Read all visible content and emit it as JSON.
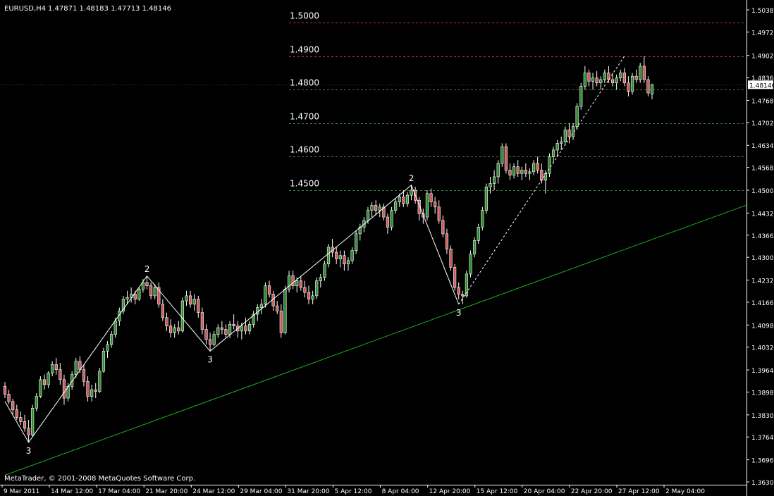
{
  "header": {
    "symbol": "EURUSD,H4",
    "ohlc": "1.47871 1.48183 1.47713 1.48146"
  },
  "footer": {
    "copyright": "MetaTrader, © 2001-2008 MetaQuotes Software Corp."
  },
  "colors": {
    "background": "#000000",
    "axis": "#ffffff",
    "candle_up": "#2e8b2e",
    "candle_down": "#cc5a5a",
    "fib_red": "#a84040",
    "fib_green": "#3a8a3a",
    "trendline": "#1fae1f",
    "wave": "#ffffff",
    "price_box": "#ffffff"
  },
  "chart_data": {
    "type": "candlestick",
    "title": "EURUSD,H4",
    "price_axis_ticks": [
      "1.50380",
      "1.49720",
      "1.49020",
      "1.48360",
      "1.48146",
      "1.47680",
      "1.47020",
      "1.46340",
      "1.45680",
      "1.45000",
      "1.44320",
      "1.43660",
      "1.43000",
      "1.42320",
      "1.41660",
      "1.40980",
      "1.40320",
      "1.39640",
      "1.38980",
      "1.38300",
      "1.37640",
      "1.36960",
      "1.36300"
    ],
    "time_axis_ticks": [
      "9 Mar 2011",
      "14 Mar 12:00",
      "17 Mar 04:00",
      "21 Mar 20:00",
      "24 Mar 12:00",
      "29 Mar 04:00",
      "31 Mar 20:00",
      "5 Apr 12:00",
      "8 Apr 04:00",
      "12 Apr 20:00",
      "15 Apr 12:00",
      "20 Apr 04:00",
      "22 Apr 20:00",
      "27 Apr 12:00",
      "2 May 04:00"
    ],
    "ylim": [
      1.363,
      1.5038
    ],
    "current_price": "1.48146",
    "levels": [
      {
        "label": "1.5000",
        "price": 1.5,
        "color": "red"
      },
      {
        "label": "1.4900",
        "price": 1.49,
        "color": "red"
      },
      {
        "label": "1.4800",
        "price": 1.48,
        "color": "green"
      },
      {
        "label": "1.4700",
        "price": 1.47,
        "color": "green"
      },
      {
        "label": "1.4600",
        "price": 1.46,
        "color": "green"
      },
      {
        "label": "1.4500",
        "price": 1.45,
        "color": "green"
      }
    ],
    "wave_labels": [
      {
        "text": "3",
        "bar": 6,
        "price": 1.3748
      },
      {
        "text": "2",
        "bar": 36,
        "price": 1.4244
      },
      {
        "text": "3",
        "bar": 52,
        "price": 1.402
      },
      {
        "text": "2",
        "bar": 103,
        "price": 1.4515
      },
      {
        "text": "3",
        "bar": 115,
        "price": 1.416
      }
    ],
    "trendline": {
      "from": {
        "bar": 0,
        "price": 1.365
      },
      "to": {
        "bar": 182,
        "price": 1.4455
      }
    },
    "wave_path": [
      {
        "bar": 0,
        "price": 1.387
      },
      {
        "bar": 6,
        "price": 1.3748
      },
      {
        "bar": 36,
        "price": 1.4244
      },
      {
        "bar": 52,
        "price": 1.402
      },
      {
        "bar": 103,
        "price": 1.4515
      },
      {
        "bar": 115,
        "price": 1.416
      }
    ],
    "projection": {
      "from": {
        "bar": 115,
        "price": 1.416
      },
      "to": {
        "bar": 157,
        "price": 1.49
      }
    },
    "candles": [
      [
        1.3915,
        1.3928,
        1.388,
        1.3892
      ],
      [
        1.3892,
        1.3905,
        1.3862,
        1.387
      ],
      [
        1.387,
        1.3878,
        1.383,
        1.3845
      ],
      [
        1.3845,
        1.386,
        1.3815,
        1.3822
      ],
      [
        1.3822,
        1.384,
        1.38,
        1.381
      ],
      [
        1.381,
        1.383,
        1.378,
        1.379
      ],
      [
        1.379,
        1.3815,
        1.3748,
        1.377
      ],
      [
        1.377,
        1.386,
        1.3765,
        1.385
      ],
      [
        1.385,
        1.3895,
        1.384,
        1.3885
      ],
      [
        1.3885,
        1.3945,
        1.388,
        1.3935
      ],
      [
        1.3935,
        1.395,
        1.3905,
        1.392
      ],
      [
        1.392,
        1.396,
        1.391,
        1.3955
      ],
      [
        1.3955,
        1.399,
        1.3945,
        1.398
      ],
      [
        1.398,
        1.4,
        1.395,
        1.3965
      ],
      [
        1.3965,
        1.3985,
        1.392,
        1.3935
      ],
      [
        1.3935,
        1.395,
        1.386,
        1.388
      ],
      [
        1.388,
        1.3925,
        1.387,
        1.3915
      ],
      [
        1.3915,
        1.396,
        1.3905,
        1.395
      ],
      [
        1.395,
        1.4,
        1.394,
        1.399
      ],
      [
        1.399,
        1.4005,
        1.3955,
        1.3965
      ],
      [
        1.3965,
        1.398,
        1.3915,
        1.393
      ],
      [
        1.393,
        1.3945,
        1.387,
        1.3885
      ],
      [
        1.3885,
        1.392,
        1.387,
        1.3905
      ],
      [
        1.3905,
        1.3925,
        1.388,
        1.39
      ],
      [
        1.39,
        1.397,
        1.3895,
        1.396
      ],
      [
        1.396,
        1.403,
        1.3955,
        1.402
      ],
      [
        1.402,
        1.405,
        1.4,
        1.404
      ],
      [
        1.404,
        1.408,
        1.403,
        1.407
      ],
      [
        1.407,
        1.412,
        1.406,
        1.411
      ],
      [
        1.411,
        1.415,
        1.4095,
        1.414
      ],
      [
        1.414,
        1.4185,
        1.413,
        1.4175
      ],
      [
        1.4175,
        1.42,
        1.416,
        1.418
      ],
      [
        1.418,
        1.421,
        1.4165,
        1.419
      ],
      [
        1.419,
        1.42,
        1.416,
        1.4175
      ],
      [
        1.4175,
        1.421,
        1.417,
        1.4205
      ],
      [
        1.4205,
        1.4235,
        1.4195,
        1.4225
      ],
      [
        1.4225,
        1.4244,
        1.4205,
        1.4215
      ],
      [
        1.4215,
        1.4225,
        1.4175,
        1.4185
      ],
      [
        1.4185,
        1.422,
        1.4175,
        1.421
      ],
      [
        1.421,
        1.4225,
        1.415,
        1.416
      ],
      [
        1.416,
        1.4175,
        1.411,
        1.412
      ],
      [
        1.412,
        1.4135,
        1.408,
        1.4095
      ],
      [
        1.4095,
        1.4115,
        1.406,
        1.4075
      ],
      [
        1.4075,
        1.41,
        1.406,
        1.409
      ],
      [
        1.409,
        1.411,
        1.407,
        1.408
      ],
      [
        1.408,
        1.418,
        1.4075,
        1.417
      ],
      [
        1.417,
        1.42,
        1.4155,
        1.4185
      ],
      [
        1.4185,
        1.42,
        1.415,
        1.416
      ],
      [
        1.416,
        1.419,
        1.414,
        1.4175
      ],
      [
        1.4175,
        1.4185,
        1.412,
        1.4135
      ],
      [
        1.4135,
        1.415,
        1.407,
        1.4085
      ],
      [
        1.4085,
        1.41,
        1.404,
        1.4055
      ],
      [
        1.4055,
        1.4075,
        1.402,
        1.404
      ],
      [
        1.404,
        1.408,
        1.4035,
        1.407
      ],
      [
        1.407,
        1.41,
        1.406,
        1.409
      ],
      [
        1.409,
        1.411,
        1.407,
        1.4085
      ],
      [
        1.4085,
        1.41,
        1.406,
        1.407
      ],
      [
        1.407,
        1.411,
        1.406,
        1.41
      ],
      [
        1.41,
        1.413,
        1.4085,
        1.4095
      ],
      [
        1.4095,
        1.411,
        1.406,
        1.408
      ],
      [
        1.408,
        1.4105,
        1.4055,
        1.4095
      ],
      [
        1.4095,
        1.412,
        1.407,
        1.408
      ],
      [
        1.408,
        1.411,
        1.407,
        1.41
      ],
      [
        1.41,
        1.414,
        1.409,
        1.413
      ],
      [
        1.413,
        1.416,
        1.411,
        1.415
      ],
      [
        1.415,
        1.4175,
        1.413,
        1.416
      ],
      [
        1.416,
        1.4225,
        1.415,
        1.4215
      ],
      [
        1.4215,
        1.423,
        1.418,
        1.419
      ],
      [
        1.419,
        1.42,
        1.414,
        1.4155
      ],
      [
        1.4155,
        1.417,
        1.413,
        1.414
      ],
      [
        1.414,
        1.416,
        1.406,
        1.4075
      ],
      [
        1.4075,
        1.4215,
        1.407,
        1.4205
      ],
      [
        1.4205,
        1.426,
        1.4195,
        1.4245
      ],
      [
        1.4245,
        1.426,
        1.4205,
        1.4215
      ],
      [
        1.4215,
        1.424,
        1.4195,
        1.423
      ],
      [
        1.423,
        1.4245,
        1.42,
        1.421
      ],
      [
        1.421,
        1.423,
        1.418,
        1.4195
      ],
      [
        1.4195,
        1.4215,
        1.416,
        1.4175
      ],
      [
        1.4175,
        1.42,
        1.416,
        1.4185
      ],
      [
        1.4185,
        1.424,
        1.4175,
        1.423
      ],
      [
        1.423,
        1.425,
        1.421,
        1.424
      ],
      [
        1.424,
        1.429,
        1.423,
        1.428
      ],
      [
        1.428,
        1.434,
        1.427,
        1.433
      ],
      [
        1.433,
        1.4355,
        1.43,
        1.4315
      ],
      [
        1.4315,
        1.433,
        1.428,
        1.4295
      ],
      [
        1.4295,
        1.432,
        1.427,
        1.4305
      ],
      [
        1.4305,
        1.432,
        1.426,
        1.428
      ],
      [
        1.428,
        1.43,
        1.426,
        1.429
      ],
      [
        1.429,
        1.433,
        1.428,
        1.432
      ],
      [
        1.432,
        1.438,
        1.431,
        1.437
      ],
      [
        1.437,
        1.44,
        1.435,
        1.439
      ],
      [
        1.439,
        1.442,
        1.4375,
        1.441
      ],
      [
        1.441,
        1.445,
        1.44,
        1.444
      ],
      [
        1.444,
        1.4465,
        1.442,
        1.4455
      ],
      [
        1.4455,
        1.447,
        1.4425,
        1.444
      ],
      [
        1.444,
        1.446,
        1.442,
        1.445
      ],
      [
        1.445,
        1.446,
        1.441,
        1.442
      ],
      [
        1.442,
        1.443,
        1.437,
        1.439
      ],
      [
        1.439,
        1.445,
        1.438,
        1.444
      ],
      [
        1.444,
        1.4475,
        1.443,
        1.4465
      ],
      [
        1.4465,
        1.449,
        1.445,
        1.448
      ],
      [
        1.448,
        1.45,
        1.445,
        1.446
      ],
      [
        1.446,
        1.4495,
        1.445,
        1.4485
      ],
      [
        1.4485,
        1.4515,
        1.447,
        1.45
      ],
      [
        1.45,
        1.451,
        1.446,
        1.447
      ],
      [
        1.447,
        1.448,
        1.441,
        1.443
      ],
      [
        1.443,
        1.4445,
        1.44,
        1.442
      ],
      [
        1.442,
        1.45,
        1.441,
        1.449
      ],
      [
        1.449,
        1.4505,
        1.445,
        1.4465
      ],
      [
        1.4465,
        1.448,
        1.443,
        1.445
      ],
      [
        1.445,
        1.447,
        1.44,
        1.441
      ],
      [
        1.441,
        1.4425,
        1.436,
        1.437
      ],
      [
        1.437,
        1.4385,
        1.431,
        1.4325
      ],
      [
        1.4325,
        1.4335,
        1.426,
        1.427
      ],
      [
        1.427,
        1.428,
        1.42,
        1.421
      ],
      [
        1.421,
        1.4225,
        1.4175,
        1.419
      ],
      [
        1.419,
        1.42,
        1.416,
        1.4185
      ],
      [
        1.4185,
        1.426,
        1.418,
        1.425
      ],
      [
        1.425,
        1.432,
        1.424,
        1.431
      ],
      [
        1.431,
        1.436,
        1.43,
        1.435
      ],
      [
        1.435,
        1.44,
        1.434,
        1.439
      ],
      [
        1.439,
        1.445,
        1.438,
        1.444
      ],
      [
        1.444,
        1.452,
        1.443,
        1.451
      ],
      [
        1.451,
        1.454,
        1.449,
        1.452
      ],
      [
        1.452,
        1.456,
        1.45,
        1.454
      ],
      [
        1.454,
        1.459,
        1.452,
        1.458
      ],
      [
        1.458,
        1.464,
        1.457,
        1.463
      ],
      [
        1.463,
        1.464,
        1.455,
        1.456
      ],
      [
        1.456,
        1.458,
        1.453,
        1.4545
      ],
      [
        1.4545,
        1.458,
        1.4535,
        1.457
      ],
      [
        1.457,
        1.459,
        1.454,
        1.455
      ],
      [
        1.455,
        1.457,
        1.453,
        1.456
      ],
      [
        1.456,
        1.458,
        1.454,
        1.455
      ],
      [
        1.455,
        1.4565,
        1.453,
        1.4555
      ],
      [
        1.4555,
        1.459,
        1.4545,
        1.458
      ],
      [
        1.458,
        1.46,
        1.455,
        1.456
      ],
      [
        1.456,
        1.458,
        1.452,
        1.453
      ],
      [
        1.453,
        1.456,
        1.449,
        1.455
      ],
      [
        1.455,
        1.461,
        1.454,
        1.46
      ],
      [
        1.46,
        1.463,
        1.458,
        1.462
      ],
      [
        1.462,
        1.465,
        1.46,
        1.464
      ],
      [
        1.464,
        1.466,
        1.462,
        1.4645
      ],
      [
        1.4645,
        1.469,
        1.4635,
        1.468
      ],
      [
        1.468,
        1.47,
        1.464,
        1.466
      ],
      [
        1.466,
        1.47,
        1.465,
        1.469
      ],
      [
        1.469,
        1.476,
        1.468,
        1.475
      ],
      [
        1.475,
        1.482,
        1.474,
        1.481
      ],
      [
        1.481,
        1.487,
        1.48,
        1.485
      ],
      [
        1.485,
        1.486,
        1.481,
        1.4825
      ],
      [
        1.4825,
        1.485,
        1.48,
        1.4835
      ],
      [
        1.4835,
        1.4855,
        1.481,
        1.482
      ],
      [
        1.482,
        1.484,
        1.48,
        1.483
      ],
      [
        1.483,
        1.486,
        1.482,
        1.485
      ],
      [
        1.485,
        1.487,
        1.482,
        1.483
      ],
      [
        1.483,
        1.485,
        1.481,
        1.482
      ],
      [
        1.482,
        1.4845,
        1.48,
        1.4835
      ],
      [
        1.4835,
        1.486,
        1.4825,
        1.485
      ],
      [
        1.485,
        1.4865,
        1.481,
        1.482
      ],
      [
        1.482,
        1.484,
        1.478,
        1.4795
      ],
      [
        1.4795,
        1.485,
        1.4785,
        1.484
      ],
      [
        1.484,
        1.486,
        1.482,
        1.483
      ],
      [
        1.483,
        1.488,
        1.482,
        1.487
      ],
      [
        1.487,
        1.49,
        1.482,
        1.483
      ],
      [
        1.483,
        1.484,
        1.478,
        1.479
      ],
      [
        1.4787,
        1.4818,
        1.4771,
        1.4815
      ]
    ]
  }
}
